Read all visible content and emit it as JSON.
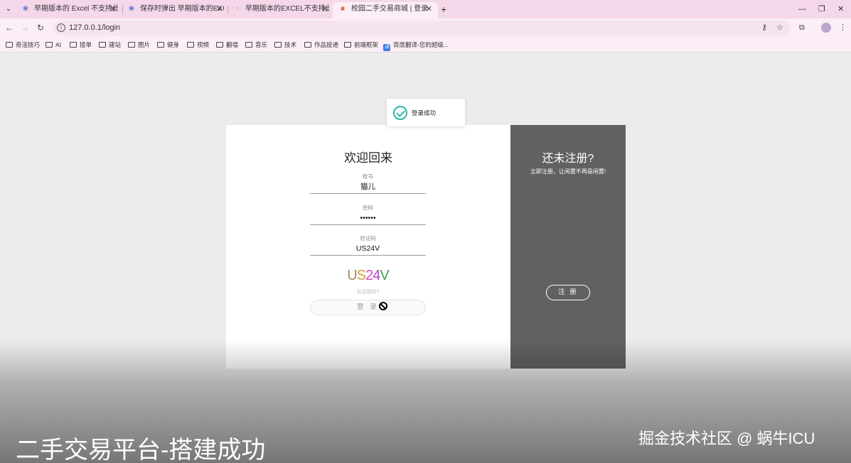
{
  "browser": {
    "tabs": [
      {
        "title": "早期版本的 Excel 不支持此工作",
        "favicon": "❀",
        "favicon_color": "#4a6fd6",
        "active": false
      },
      {
        "title": "保存时弹出 早期版本的EXCEL不",
        "favicon": "❀",
        "favicon_color": "#4a6fd6",
        "active": false
      },
      {
        "title": "早期版本的EXCEL不支持此工作",
        "favicon": "◔",
        "favicon_color": "#d9a43a",
        "active": false
      },
      {
        "title": "校园二手交易商城 | 登录",
        "favicon": "■",
        "favicon_color": "#e46b36",
        "active": true
      }
    ],
    "url": "127.0.0.1/login",
    "bookmarks": [
      "奇淫技巧",
      "AI",
      "接单",
      "建站",
      "图片",
      "健身",
      "视频",
      "翻墙",
      "音乐",
      "技术",
      "作品投递",
      "前端框架",
      "百度翻译-您的超级..."
    ]
  },
  "toast": {
    "message": "登录成功"
  },
  "login": {
    "title": "欢迎回来",
    "account_label": "账号",
    "account_value": "猫儿",
    "password_label": "密码",
    "password_value": "••••••",
    "captcha_label": "验证码",
    "captcha_value": "US24V",
    "captcha_chars": [
      {
        "ch": "U",
        "color": "#9a8a5a"
      },
      {
        "ch": "S",
        "color": "#c9a23a"
      },
      {
        "ch": "2",
        "color": "#d64ac9"
      },
      {
        "ch": "4",
        "color": "#c43ad0"
      },
      {
        "ch": "V",
        "color": "#3aa74a"
      }
    ],
    "forgot": "忘记密码?",
    "submit": "登 录"
  },
  "signup": {
    "title": "还未注册?",
    "subtitle": "立即注册，让闲置不再是闲置!",
    "button": "注 册"
  },
  "overlay": {
    "caption": "二手交易平台-搭建成功",
    "watermark": "掘金技术社区 @ 蜗牛ICU"
  }
}
